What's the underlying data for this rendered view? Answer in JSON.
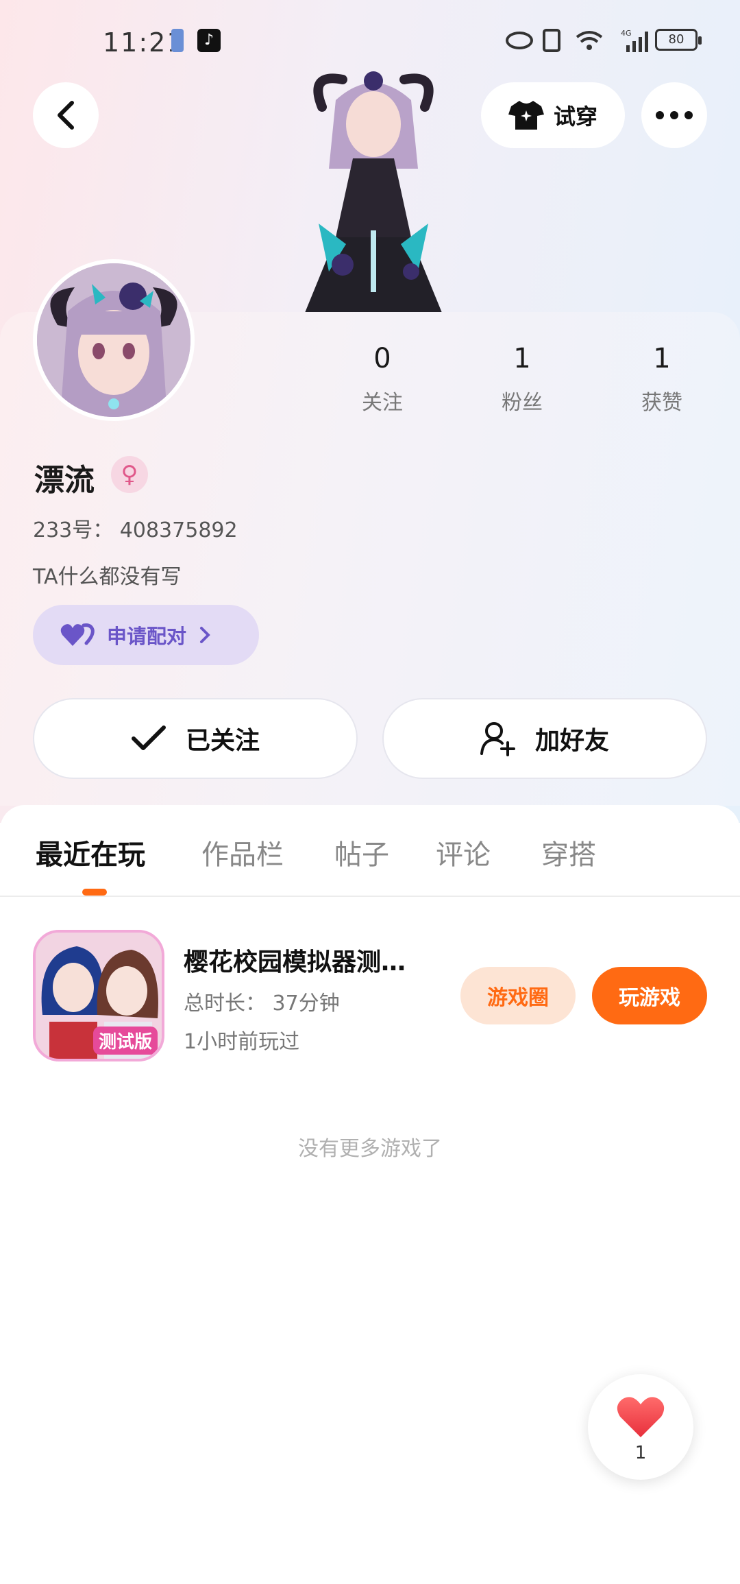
{
  "status_bar": {
    "time": "11:21",
    "battery": "80"
  },
  "header": {
    "tryon_label": "试穿"
  },
  "stats": [
    {
      "value": "0",
      "label": "关注"
    },
    {
      "value": "1",
      "label": "粉丝"
    },
    {
      "value": "1",
      "label": "获赞"
    }
  ],
  "profile": {
    "name": "漂流",
    "gender_symbol": "♀",
    "uid": "233号： 408375892",
    "bio": "TA什么都没有写",
    "match_label": "申请配对"
  },
  "actions": {
    "followed_label": "已关注",
    "add_friend_label": "加好友"
  },
  "tabs": [
    {
      "label": "最近在玩",
      "active": true
    },
    {
      "label": "作品栏",
      "active": false
    },
    {
      "label": "帖子",
      "active": false
    },
    {
      "label": "评论",
      "active": false
    },
    {
      "label": "穿搭",
      "active": false
    }
  ],
  "games": [
    {
      "title": "樱花校园模拟器测…",
      "duration": "总时长： 37分钟",
      "last_played": "1小时前玩过",
      "icon_badge": "测试版",
      "circle_label": "游戏圈",
      "play_label": "玩游戏"
    }
  ],
  "no_more_text": "没有更多游戏了",
  "like_fab": {
    "count": "1"
  },
  "colors": {
    "accent": "#ff6a13",
    "match": "#6a55c8"
  }
}
